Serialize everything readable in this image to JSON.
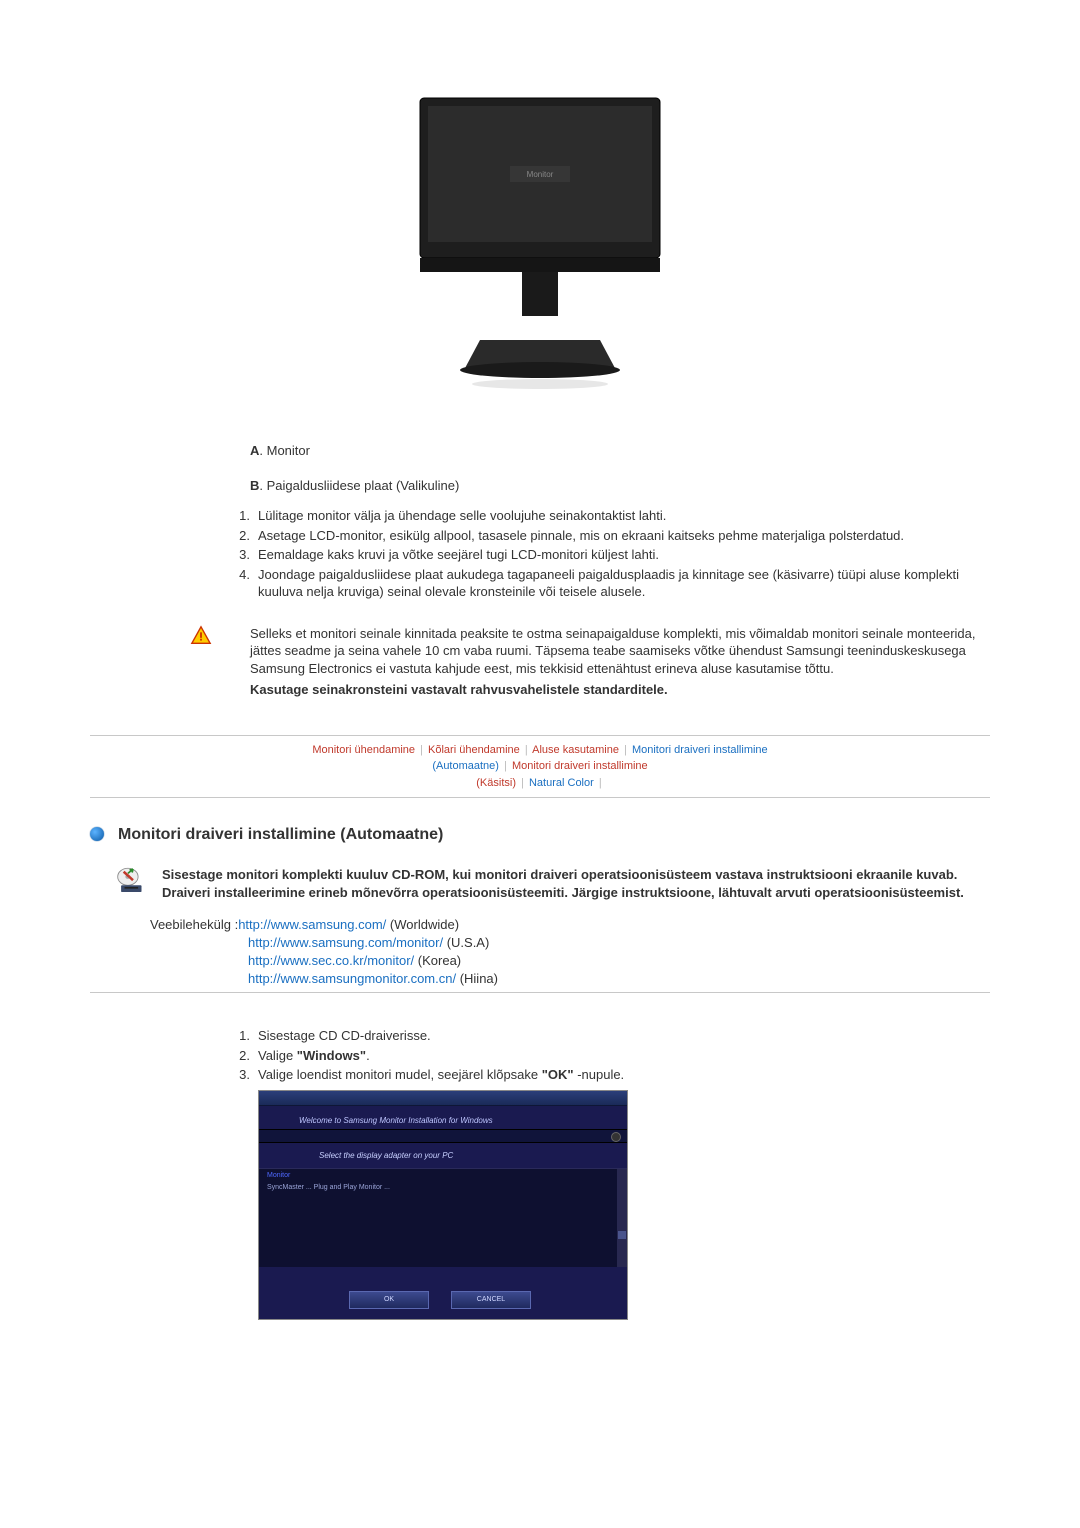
{
  "figure": {
    "monitor_label": "Monitor"
  },
  "labels": {
    "A": "A",
    "A_text": ". Monitor",
    "B": "B",
    "B_text": ". Paigaldusliidese plaat (Valikuline)"
  },
  "instructions": [
    {
      "n": "1.",
      "t": "Lülitage monitor välja ja ühendage selle voolujuhe seinakontaktist lahti."
    },
    {
      "n": "2.",
      "t": "Asetage LCD-monitor, esikülg allpool, tasasele pinnale, mis on ekraani kaitseks pehme materjaliga polsterdatud."
    },
    {
      "n": "3.",
      "t": "Eemaldage kaks kruvi ja võtke seejärel tugi LCD-monitori küljest lahti."
    },
    {
      "n": "4.",
      "t": "Joondage paigaldusliidese plaat aukudega tagapaneeli paigaldusplaadis ja kinnitage see (käsivarre) tüüpi aluse komplekti kuuluva nelja kruviga) seinal olevale kronsteinile või teisele alusele."
    }
  ],
  "warning": {
    "text": "Selleks et monitori seinale kinnitada peaksite te ostma seinapaigalduse komplekti, mis võimaldab monitori seinale monteerida, jättes seadme ja seina vahele 10 cm vaba ruumi. Täpsema teabe saamiseks võtke ühendust Samsungi teeninduskeskusega Samsung Electronics ei vastuta kahjude eest, mis tekkisid ettenähtust erineva aluse kasutamise tõttu.",
    "bold": "Kasutage seinakronsteini vastavalt rahvusvahelistele standarditele."
  },
  "linkbar": {
    "a": "Monitori ühendamine",
    "b": "Kõlari ühendamine",
    "c": "Aluse kasutamine",
    "d": "Monitori draiveri installimine",
    "d_sub": "(Automaatne)",
    "e": "Monitori draiveri installimine",
    "e_sub": "(Käsitsi)",
    "f": "Natural Color"
  },
  "section": {
    "heading": "Monitori draiveri installimine (Automaatne)"
  },
  "cdnote": "Sisestage monitori komplekti kuuluv CD-ROM, kui monitori draiveri operatsioonisüsteem vastava instruktsiooni ekraanile kuvab. Draiveri installeerimine erineb mõnevõrra operatsioonisüsteemiti. Järgige instruktsioone, lähtuvalt arvuti operatsioonisüsteemist.",
  "weblinks": {
    "label": "Veebilehekülg :",
    "items": [
      {
        "url": "http://www.samsung.com/",
        "loc": " (Worldwide)"
      },
      {
        "url": "http://www.samsung.com/monitor/",
        "loc": " (U.S.A)"
      },
      {
        "url": "http://www.sec.co.kr/monitor/",
        "loc": " (Korea)"
      },
      {
        "url": "http://www.samsungmonitor.com.cn/",
        "loc": " (Hiina)"
      }
    ]
  },
  "steps": [
    {
      "n": "1.",
      "t": "Sisestage CD CD-draiverisse."
    },
    {
      "n": "2.",
      "pre": "Valige ",
      "bold": "\"Windows\"",
      "post": "."
    },
    {
      "n": "3.",
      "pre": "Valige loendist monitori mudel, seejärel klõpsake ",
      "bold": "\"OK\"",
      "post": " -nupule."
    }
  ],
  "installer": {
    "topline": "Welcome to Samsung Monitor Installation for Windows",
    "midline": "Select the display adapter on your PC",
    "listhead": "Monitor",
    "listrow": "SyncMaster ... Plug and Play Monitor ...",
    "btn_ok": "OK",
    "btn_cancel": "CANCEL"
  }
}
